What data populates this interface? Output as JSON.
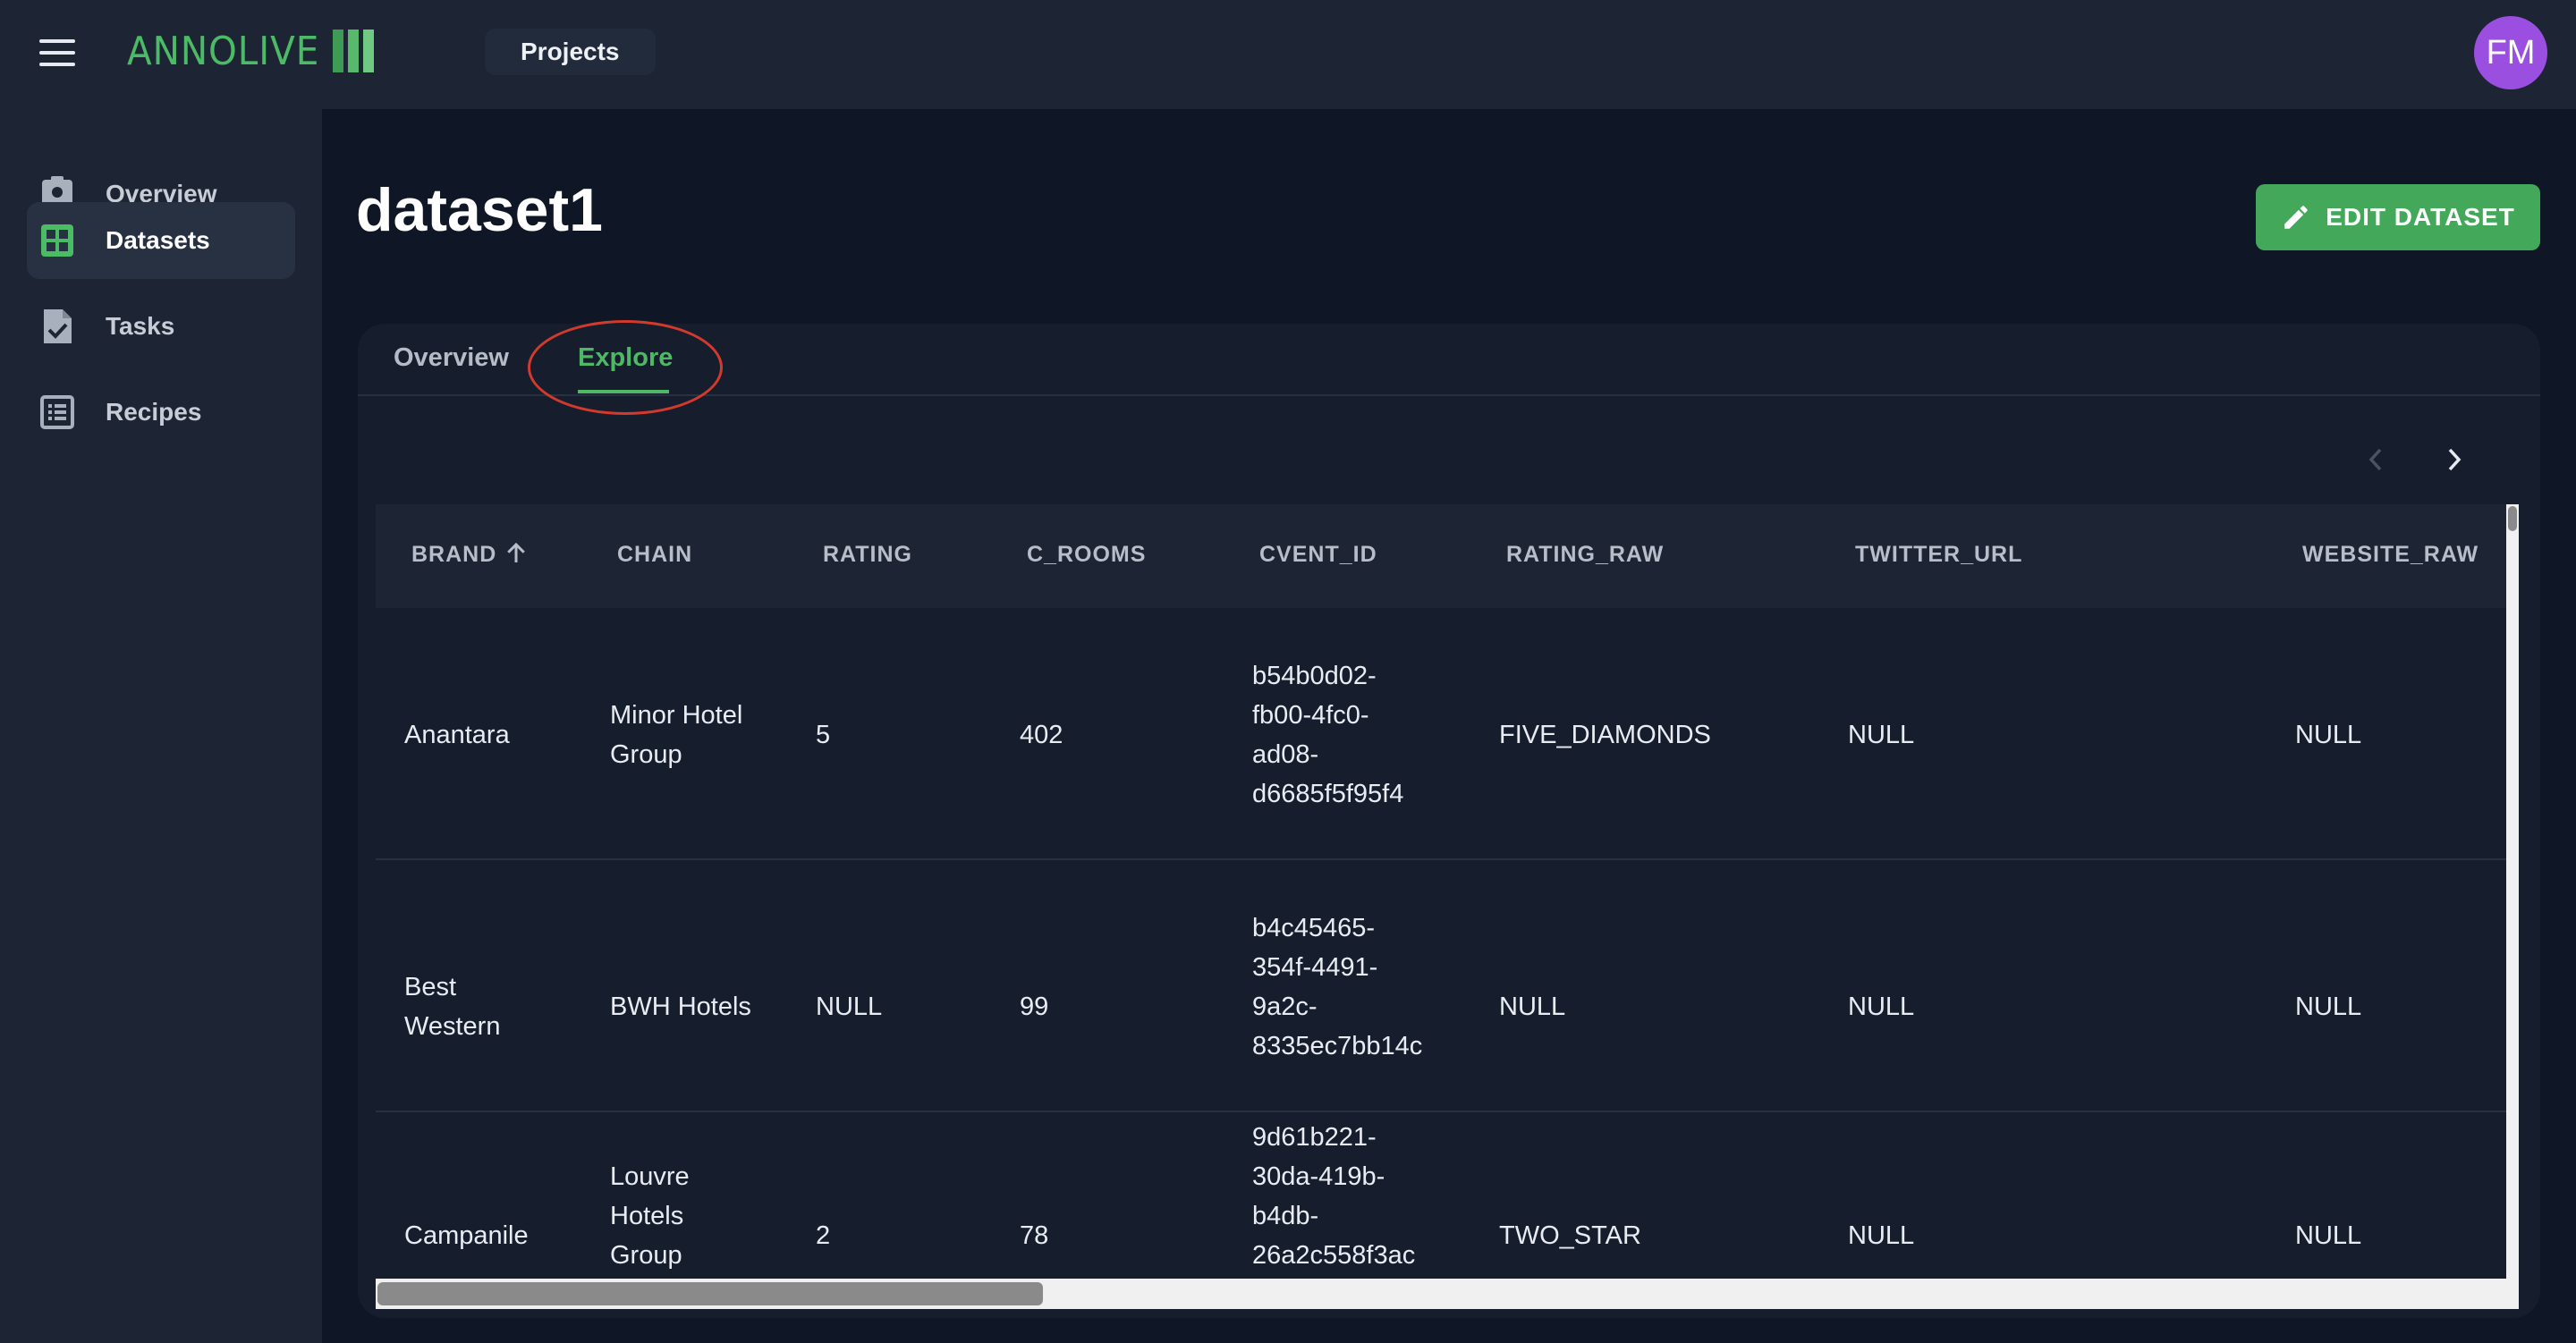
{
  "topbar": {
    "logo_text": "ANNOLIVE",
    "projects_label": "Projects",
    "avatar_initials": "FM",
    "avatar_color": "#9b4fe0"
  },
  "sidebar": {
    "items": [
      {
        "label": "Overview",
        "icon": "clipboard-account-icon",
        "active": false
      },
      {
        "label": "Datasets",
        "icon": "grid-icon",
        "active": true
      },
      {
        "label": "Tasks",
        "icon": "file-check-icon",
        "active": false
      },
      {
        "label": "Recipes",
        "icon": "list-box-icon",
        "active": false
      }
    ]
  },
  "page": {
    "title": "dataset1",
    "edit_button": "EDIT DATASET",
    "accent_color": "#43a85a"
  },
  "tabs": [
    {
      "label": "Overview",
      "active": false
    },
    {
      "label": "Explore",
      "active": true
    }
  ],
  "table": {
    "columns": [
      "BRAND",
      "CHAIN",
      "RATING",
      "C_ROOMS",
      "CVENT_ID",
      "RATING_RAW",
      "TWITTER_URL",
      "WEBSITE_RAW"
    ],
    "sorted_column": "BRAND",
    "sort_direction": "ascending",
    "rows": [
      {
        "brand": [
          "Anantara"
        ],
        "chain": [
          "Minor Hotel",
          "Group"
        ],
        "rating": "5",
        "c_rooms": "402",
        "cvent_id": [
          "b54b0d02-",
          "fb00-4fc0-",
          "ad08-",
          "d6685f5f95f4"
        ],
        "rating_raw": "FIVE_DIAMONDS",
        "twitter_url": "NULL",
        "website_raw": "NULL"
      },
      {
        "brand": [
          "Best",
          "Western"
        ],
        "chain": [
          "BWH Hotels"
        ],
        "rating": "NULL",
        "c_rooms": "99",
        "cvent_id": [
          "b4c45465-",
          "354f-4491-",
          "9a2c-",
          "8335ec7bb14c"
        ],
        "rating_raw": "NULL",
        "twitter_url": "NULL",
        "website_raw": "NULL"
      },
      {
        "brand": [
          "Campanile"
        ],
        "chain": [
          "Louvre",
          "Hotels",
          "Group"
        ],
        "rating": "2",
        "c_rooms": "78",
        "cvent_id": [
          "9d61b221-",
          "30da-419b-",
          "b4db-",
          "26a2c558f3ac"
        ],
        "rating_raw": "TWO_STAR",
        "twitter_url": "NULL",
        "website_raw": "NULL"
      }
    ]
  }
}
